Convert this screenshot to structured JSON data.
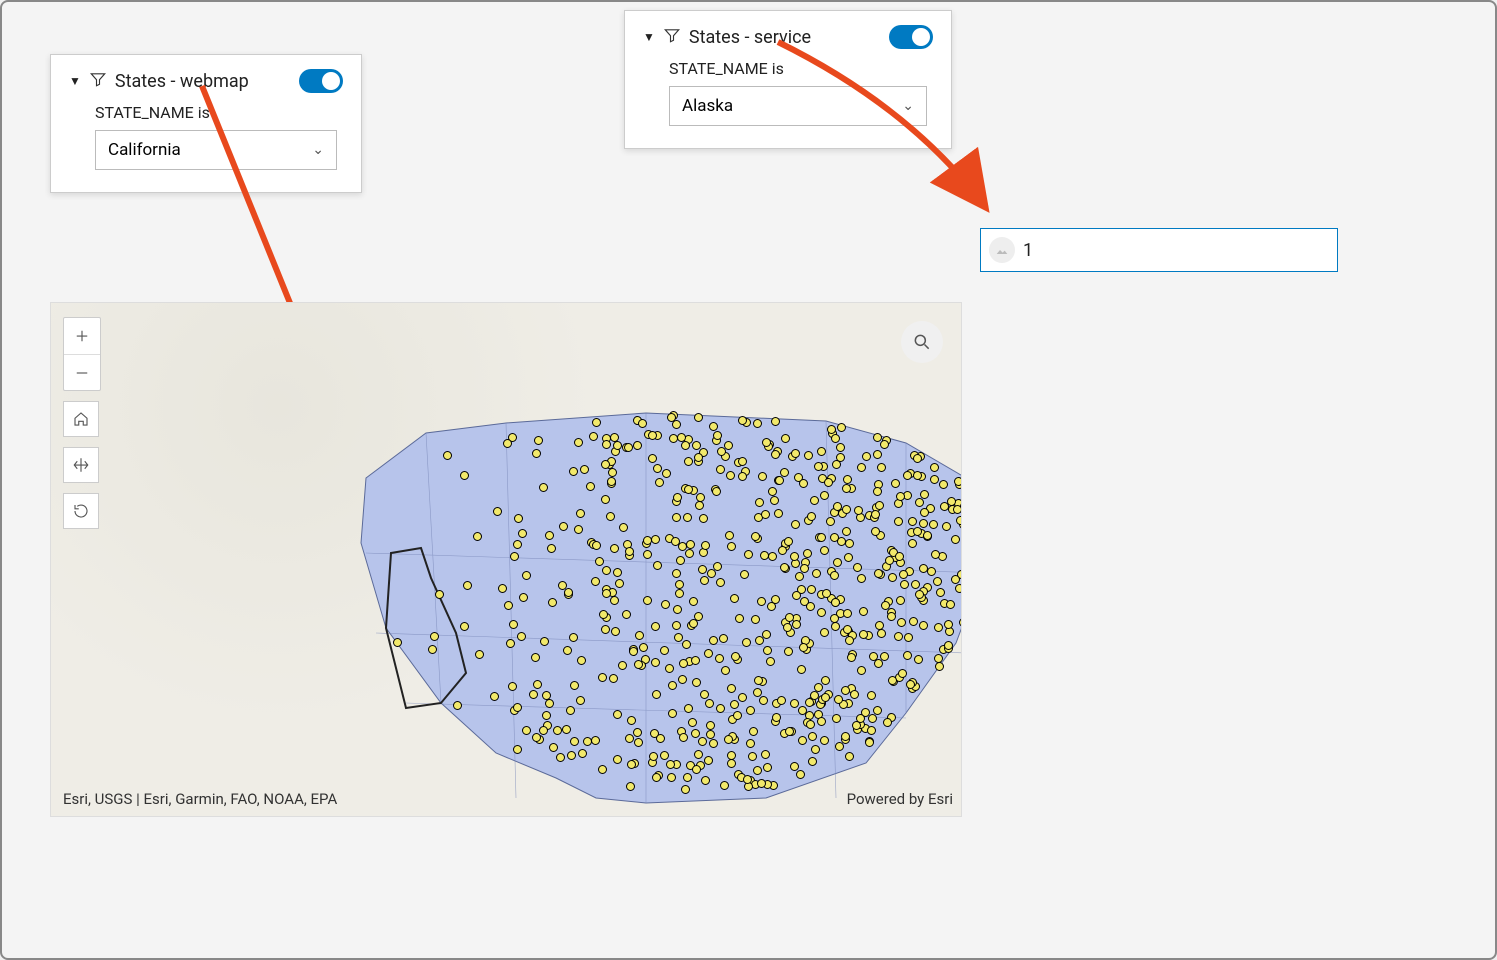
{
  "filters": {
    "webmap": {
      "title": "States - webmap",
      "field_label": "STATE_NAME is",
      "selected": "California",
      "toggle_on": true
    },
    "service": {
      "title": "States - service",
      "field_label": "STATE_NAME is",
      "selected": "Alaska",
      "toggle_on": true
    }
  },
  "result_card": {
    "value": "1"
  },
  "map": {
    "attribution": "Esri, USGS | Esri, Garmin, FAO, NOAA, EPA",
    "powered_by": "Powered by Esri"
  },
  "colors": {
    "accent": "#007ac2",
    "arrow": "#e8491d",
    "state_fill": "#b7c4eb",
    "dot_fill": "#f2e96b"
  }
}
